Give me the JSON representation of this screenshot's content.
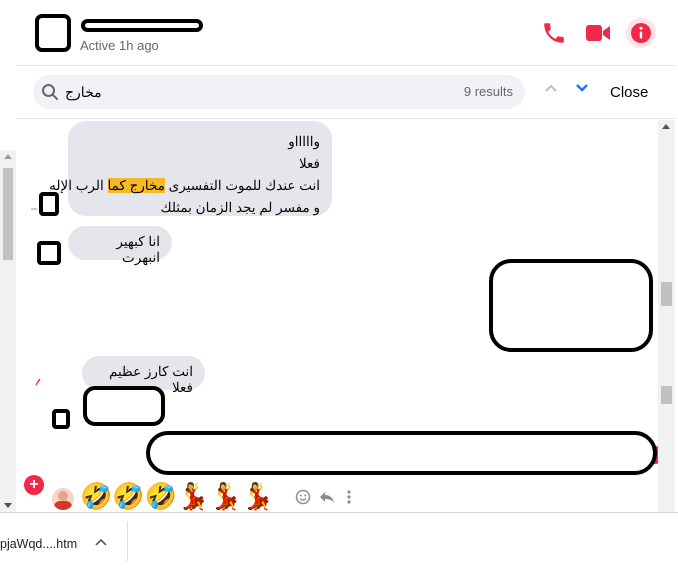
{
  "header": {
    "active_status": "Active 1h ago",
    "icons": [
      "phone-icon",
      "video-icon",
      "info-icon"
    ],
    "accent_color": "#f02849"
  },
  "search": {
    "query": "مخارج",
    "results": "9 results",
    "close_label": "Close"
  },
  "messages": [
    {
      "lines": [
        "واااااو",
        "فعلا",
        "انت عندك للموت التفسيرى",
        "و مفسر لم يجد الزمان بمثلك"
      ],
      "highlight": "مخارج كما",
      "after_highlight": "الرب الإله"
    },
    {
      "text": "انا كبهير انبهرت"
    },
    {
      "text": "انت كارز عظيم فعلا"
    }
  ],
  "reactions": {
    "emojis": "🤣🤣🤣💃💃💃",
    "actions": [
      "smile-icon",
      "reply-icon",
      "more-icon"
    ]
  },
  "download": {
    "filename": "pjaWqd....htm"
  }
}
